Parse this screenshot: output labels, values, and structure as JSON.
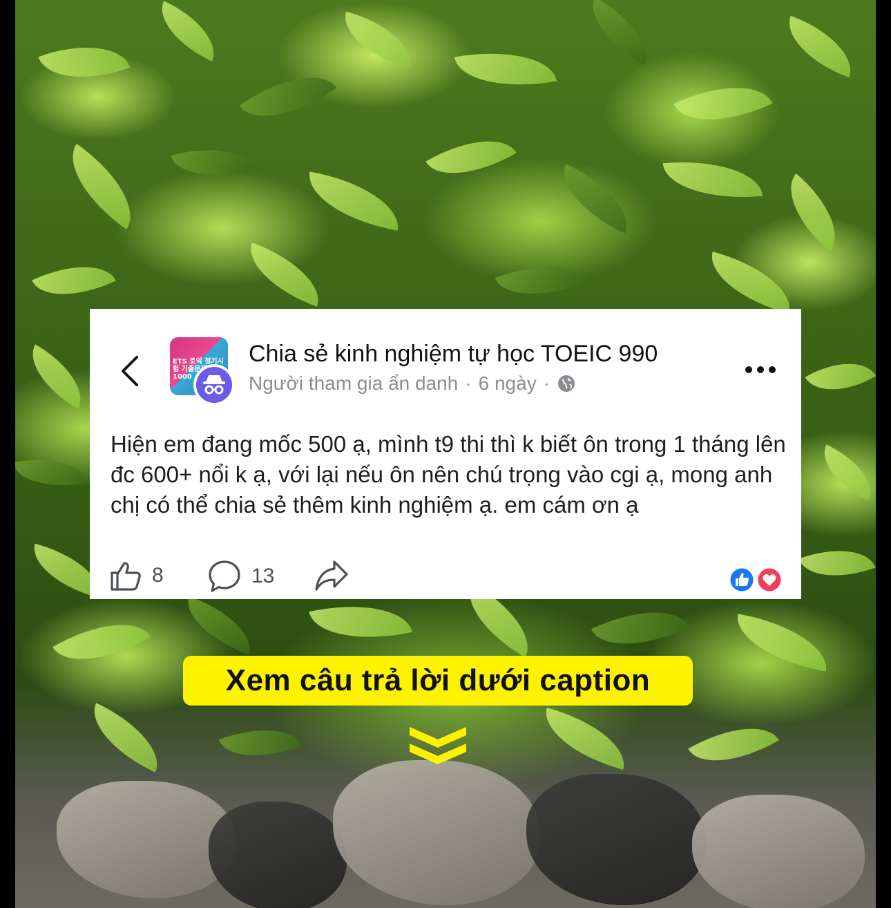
{
  "post": {
    "group_name": "Chia sẻ kinh nghiệm tự học TOEIC 990",
    "author": "Người tham gia ẩn danh",
    "separator": "·",
    "time": "6 ngày",
    "body": "Hiện em đang mốc 500 ạ, mình t9 thi thì k biết ôn trong 1 tháng lên đc 600+ nổi k ạ, với lại nếu ôn nên chú trọng vào cgi ạ, mong anh chị có thể chia sẻ thêm kinh nghiệm ạ. em cám ơn ạ",
    "group_avatar_text": "ETS 토익 정기시험 기출문제집 5 1000",
    "like_count": "8",
    "comment_count": "13",
    "reactions": [
      "like-reaction",
      "love-reaction"
    ]
  },
  "cta": {
    "label": "Xem câu trả lời dưới caption"
  },
  "colors": {
    "cta_bg": "#fff200",
    "anon_avatar": "#6b5be6",
    "like_blue": "#1877f2",
    "love_red": "#f33e58",
    "meta_grey": "#8a8d91"
  },
  "icons": [
    "back-chevron-icon",
    "globe-icon",
    "more-dots-icon",
    "like-icon",
    "comment-icon",
    "share-icon",
    "double-chevron-down-icon"
  ]
}
